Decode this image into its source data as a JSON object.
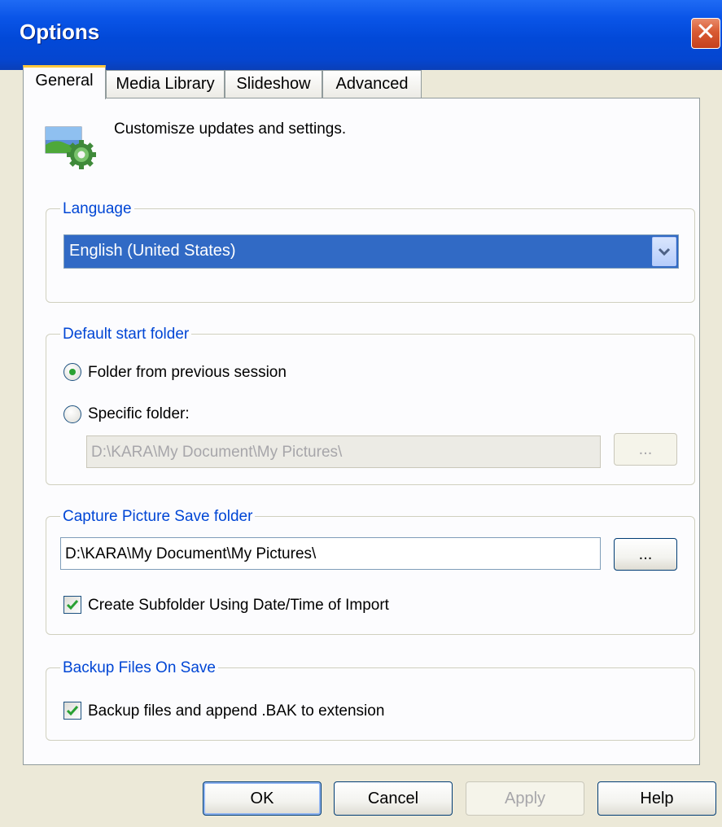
{
  "window": {
    "title": "Options",
    "close_glyph": "✕"
  },
  "tabs": [
    {
      "label": "General",
      "active": true
    },
    {
      "label": "Media Library",
      "active": false
    },
    {
      "label": "Slideshow",
      "active": false
    },
    {
      "label": "Advanced",
      "active": false
    }
  ],
  "header": {
    "text": "Customisze updates and settings.",
    "icon": "settings-gear-icon"
  },
  "language": {
    "group_title": "Language",
    "selected": "English (United States)"
  },
  "default_start_folder": {
    "group_title": "Default start folder",
    "option_previous": "Folder from previous session",
    "option_specific": "Specific folder:",
    "selected_option": "previous",
    "path": "D:\\KARA\\My Document\\My Pictures\\",
    "browse_label": "..."
  },
  "capture_folder": {
    "group_title": "Capture Picture Save folder",
    "path": "D:\\KARA\\My Document\\My Pictures\\",
    "browse_label": "...",
    "subfolder_label": "Create Subfolder Using Date/Time of Import",
    "subfolder_checked": true
  },
  "backup": {
    "group_title": "Backup Files On Save",
    "label": "Backup files and append .BAK to extension",
    "checked": true
  },
  "buttons": {
    "ok": "OK",
    "cancel": "Cancel",
    "apply": "Apply",
    "help": "Help"
  },
  "colors": {
    "titlebar": "#0249d8",
    "group_title": "#0046d5",
    "selection": "#316ac5",
    "check": "#29a132"
  }
}
